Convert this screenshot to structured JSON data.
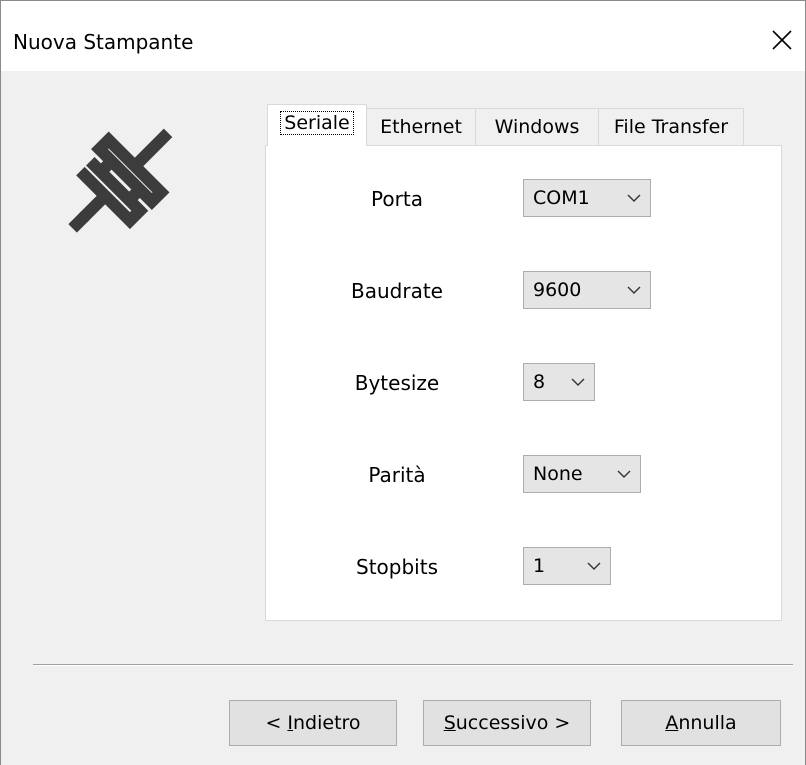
{
  "window": {
    "title": "Nuova Stampante"
  },
  "tabs": [
    {
      "label": "Seriale",
      "active": true
    },
    {
      "label": "Ethernet",
      "active": false
    },
    {
      "label": "Windows",
      "active": false
    },
    {
      "label": "File Transfer",
      "active": false
    }
  ],
  "serial_settings": {
    "porta": {
      "label": "Porta",
      "value": "COM1"
    },
    "baudrate": {
      "label": "Baudrate",
      "value": "9600"
    },
    "bytesize": {
      "label": "Bytesize",
      "value": "8"
    },
    "parita": {
      "label": "Parità",
      "value": "None"
    },
    "stopbits": {
      "label": "Stopbits",
      "value": "1"
    }
  },
  "buttons": {
    "back": {
      "prefix": "< ",
      "mnemonic": "I",
      "rest": "ndietro"
    },
    "next": {
      "mnemonic": "S",
      "rest": "uccessivo >"
    },
    "cancel": {
      "mnemonic": "A",
      "rest": "nnulla"
    }
  },
  "icons": {
    "plug": "plug-icon",
    "close": "close-icon",
    "dropdown": "chevron-down-icon"
  },
  "colors": {
    "titlebar": "#ffffff",
    "dialog_bg": "#f0f0f0",
    "panel_bg": "#ffffff",
    "icon": "#3c3c3c"
  }
}
